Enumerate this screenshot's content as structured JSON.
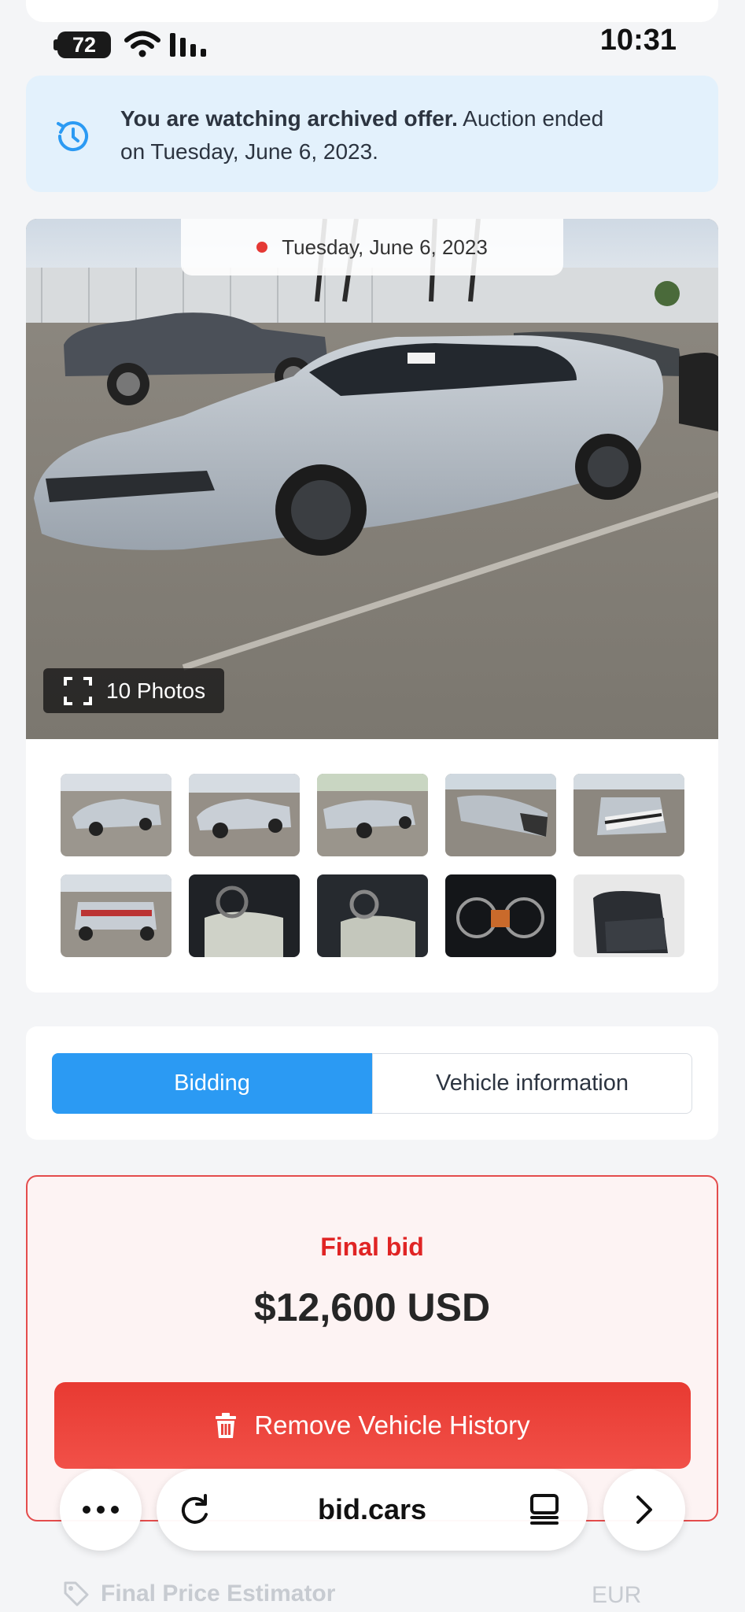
{
  "status_bar": {
    "battery": "72",
    "time": "10:31"
  },
  "notice": {
    "icon": "history-icon",
    "bold_text": "You are watching archived offer.",
    "text": " Auction ended on Tuesday, June 6, 2023."
  },
  "gallery": {
    "date_label": "Tuesday, June 6, 2023",
    "photos_label": "10 Photos",
    "icon": "fullscreen-icon"
  },
  "tabs": [
    {
      "label": "Bidding",
      "active": true
    },
    {
      "label": "Vehicle information",
      "active": false
    }
  ],
  "bid": {
    "label": "Final bid",
    "amount": "$12,600 USD",
    "remove_label": "Remove Vehicle History",
    "remove_icon": "trash-icon"
  },
  "browser": {
    "domain": "bid.cars",
    "more_icon": "more-icon",
    "reload_icon": "reload-icon",
    "tabs_icon": "tabs-icon",
    "forward_icon": "chevron-right-icon"
  },
  "estimator": {
    "label": "Final Price Estimator",
    "currency": "EUR"
  },
  "colors": {
    "accent_blue": "#2b9af3",
    "danger_red": "#e02424",
    "notice_bg": "#e3f1fc"
  }
}
